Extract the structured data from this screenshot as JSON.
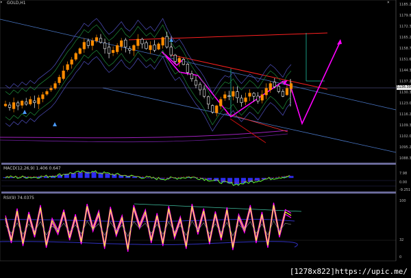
{
  "main_panel": {
    "title": "GOLD,H1",
    "price_labels": [
      "1185.20",
      "1179.80",
      "1172.30",
      "1165.20",
      "1158.70",
      "1151.60",
      "1144.30",
      "1137.20",
      "1130.30",
      "1123.00",
      "1116.20",
      "1109.30",
      "1102.00",
      "1095.20",
      "1088.30"
    ],
    "current_price": "1136.39"
  },
  "macd_panel": {
    "title": "MACD(12,26,9) 1.406 0.647",
    "scale_labels": [
      "7.98",
      "0.00",
      "-9.251"
    ]
  },
  "rsi_panel": {
    "title": "RSI(9) 74.0375",
    "scale_labels": [
      "100",
      "32",
      "0"
    ]
  },
  "colors": {
    "background": "#000000",
    "bull_candle": "#ff8c00",
    "bear_candle": "#ffffff",
    "pattern_arrow": "#ff00ff",
    "resistance": "#ff2020",
    "trend_channel": "#4a78c8",
    "macd_line": "#66ff33",
    "macd_hist": "#2d2df0",
    "rsi_line": "#ffff33",
    "rsi_envelope": "#ff00ff"
  },
  "watermark": "[1278x822]https://upic.me/",
  "chart_data": {
    "type": "candlestick",
    "title": "GOLD,H1",
    "ylim": [
      1088.3,
      1185.2
    ],
    "price_path": [
      1123,
      1121,
      1124,
      1122,
      1125,
      1123,
      1126,
      1124,
      1127,
      1129,
      1131,
      1133,
      1136,
      1140,
      1144,
      1148,
      1151,
      1155,
      1158,
      1162,
      1160,
      1163,
      1165,
      1162,
      1158,
      1155,
      1157,
      1160,
      1163,
      1159,
      1157,
      1160,
      1164,
      1161,
      1158,
      1160,
      1157,
      1161,
      1165,
      1159,
      1154,
      1150,
      1152,
      1148,
      1143,
      1139,
      1135,
      1132,
      1128,
      1123,
      1118,
      1122,
      1126,
      1129,
      1128,
      1131,
      1127,
      1124,
      1127,
      1130,
      1128,
      1125,
      1129,
      1133,
      1136,
      1134,
      1131,
      1128,
      1133,
      1136
    ],
    "macd_ylim": [
      -9.251,
      7.98
    ],
    "macd_values": [
      0.5,
      0.6,
      0.4,
      0.7,
      0.5,
      0.9,
      1.1,
      1.5,
      2.2,
      3,
      3.6,
      4,
      4.4,
      4.2,
      3.8,
      3.1,
      2.6,
      2,
      1.5,
      1,
      0.6,
      0.2,
      -0.3,
      -0.6,
      -0.4,
      -0.1,
      0.3,
      0.6,
      0.2,
      -0.5,
      -1.4,
      -2.3,
      -3.2,
      -4,
      -4.6,
      -3.8,
      -2.9,
      -2,
      -1.1,
      -0.4,
      0.3,
      0.9,
      1.4
    ],
    "rsi_ylim": [
      0,
      100
    ],
    "rsi_values": [
      70,
      30,
      82,
      25,
      76,
      40,
      88,
      22,
      65,
      45,
      80,
      35,
      72,
      28,
      90,
      50,
      78,
      20,
      85,
      42,
      70,
      15,
      88,
      55,
      80,
      30,
      74,
      25,
      86,
      38,
      68,
      20,
      90,
      45,
      82,
      28,
      77,
      35,
      84,
      18,
      72,
      48,
      88,
      30,
      76,
      22,
      92,
      40,
      80,
      74
    ],
    "annotations": [
      "current price 1136.39"
    ]
  }
}
